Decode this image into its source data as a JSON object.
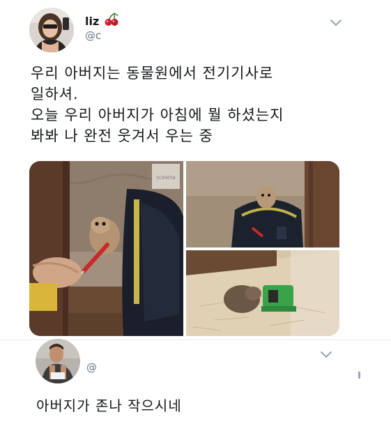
{
  "tweet": {
    "author": {
      "display_name": "liz",
      "emoji": "🍒",
      "handle": "@c"
    },
    "text_lines": [
      "우리 아버지는 동물원에서 전기기사로",
      "일하셔.",
      "오늘 우리 아버지가 아침에 뭘 하셨는지",
      "봐봐 나 완전 웃겨서 우는 중"
    ],
    "media": {
      "photo_count": 3,
      "watermark": "SCIENTIA"
    }
  },
  "reply": {
    "author": {
      "handle": "@"
    },
    "text": "아버지가 존나 작으시네"
  },
  "icons": {
    "more": "chevron-down-icon",
    "cherry": "cherry-emoji"
  },
  "colors": {
    "text": "#14171a",
    "secondary": "#657786",
    "divider": "#e6ecf0"
  }
}
